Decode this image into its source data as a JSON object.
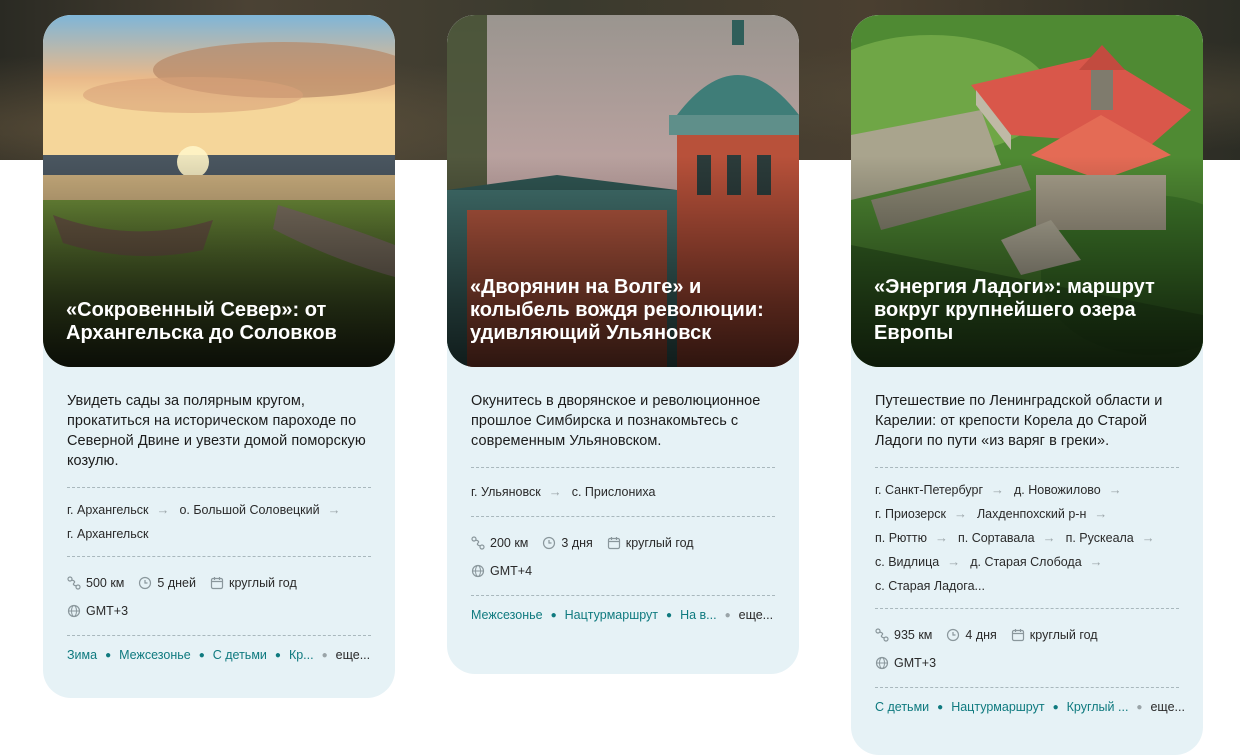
{
  "cards": [
    {
      "title": "«Сокровенный Север»: от Архангельска до Соловков",
      "description": "Увидеть сады за полярным кругом, прокатиться на историческом пароходе по Северной Двине и увезти домой поморскую козулю.",
      "route": [
        "г. Архангельск",
        "о. Большой Соловецкий",
        "г. Архангельск"
      ],
      "distance": "500 км",
      "duration": "5 дней",
      "season": "круглый год",
      "timezone": "GMT+3",
      "tags": [
        "Зима",
        "Межсезонье",
        "С детьми",
        "Кр..."
      ],
      "more": "еще..."
    },
    {
      "title": "«Дворянин на Волге» и колыбель вождя революции: удивляющий Ульяновск",
      "description": "Окунитесь в дворянское и революционное прошлое Симбирска и познакомьтесь с современным Ульяновском.",
      "route": [
        "г. Ульяновск",
        "с. Прислониха"
      ],
      "distance": "200 км",
      "duration": "3 дня",
      "season": "круглый год",
      "timezone": "GMT+4",
      "tags": [
        "Межсезонье",
        "Нацтурмаршрут",
        "На в..."
      ],
      "more": "еще..."
    },
    {
      "title": "«Энергия Ладоги»: маршрут вокруг крупнейшего озера Европы",
      "description": "Путешествие по Ленинградской области и Карелии: от крепости Корела до Старой Ладоги по пути «из варяг в греки».",
      "route": [
        "г. Санкт-Петербург",
        "д. Новожилово",
        "г. Приозерск",
        "Лахденпохский р-н",
        "п. Рюттю",
        "п. Сортавала",
        "п. Рускеала",
        "с. Видлица",
        "д. Старая Слобода",
        "с. Старая Ладога..."
      ],
      "distance": "935 км",
      "duration": "4 дня",
      "season": "круглый год",
      "timezone": "GMT+3",
      "tags": [
        "С детьми",
        "Нацтурмаршрут",
        "Круглый ..."
      ],
      "more": "еще..."
    }
  ],
  "icons": {
    "distance": "route-icon",
    "duration": "clock-icon",
    "season": "calendar-icon",
    "timezone": "globe-icon",
    "arrow": "arrow-right-icon"
  },
  "colors": {
    "accent": "#0f7a7f",
    "card_bg": "#e6f2f6",
    "text": "#1c1c1c"
  }
}
